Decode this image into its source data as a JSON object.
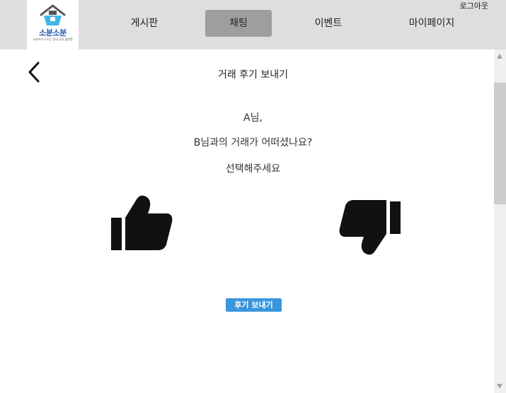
{
  "header": {
    "logo_text": "소분소분",
    "logo_sub": "소분하고 나누는 동네 공유 플랫폼",
    "nav": [
      {
        "label": "게시판"
      },
      {
        "label": "채팅"
      },
      {
        "label": "이벤트"
      },
      {
        "label": "마이페이지"
      }
    ],
    "active_tab": "채팅",
    "logout_label": "로그아웃"
  },
  "page": {
    "title": "거래 후기 보내기",
    "line1": "A님,",
    "line2": "B님과의 거래가 어떠셨나요?",
    "line3": "선택해주세요",
    "submit_label": "후기 보내기"
  },
  "icons": {
    "back": "chevron-left-icon",
    "like": "thumbs-up-icon",
    "dislike": "thumbs-down-icon",
    "logo": "house-basket-icon"
  },
  "colors": {
    "topbar": "#dedede",
    "active_tab": "#9e9e9e",
    "submit_button": "#3a96dc",
    "logo_text": "#2a5fb0"
  }
}
